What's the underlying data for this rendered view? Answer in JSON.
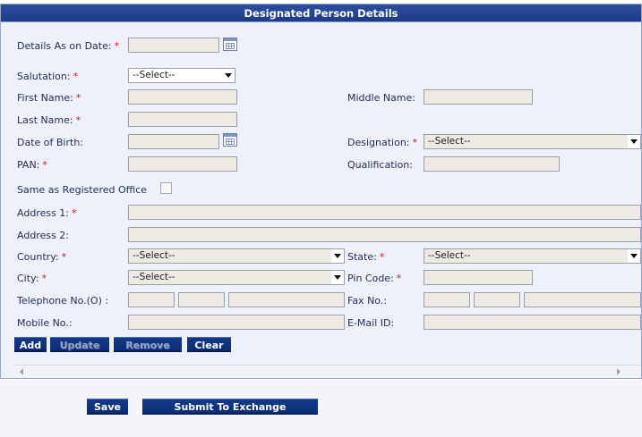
{
  "panel": {
    "title": "Designated Person Details"
  },
  "form": {
    "details_as_on_date": {
      "label": "Details As on Date:",
      "value": ""
    },
    "salutation": {
      "label": "Salutation:",
      "value": "--Select--"
    },
    "first_name": {
      "label": "First Name:",
      "value": ""
    },
    "middle_name": {
      "label": "Middle Name:",
      "value": ""
    },
    "last_name": {
      "label": "Last Name:",
      "value": ""
    },
    "date_of_birth": {
      "label": "Date of Birth:",
      "value": ""
    },
    "designation": {
      "label": "Designation:",
      "value": "--Select--"
    },
    "pan": {
      "label": "PAN:",
      "value": ""
    },
    "qualification": {
      "label": "Qualification:",
      "value": ""
    },
    "same_as_registered_office": {
      "label": "Same as Registered Office",
      "checked": false
    },
    "address1": {
      "label": "Address 1:",
      "value": ""
    },
    "address2": {
      "label": "Address 2:",
      "value": ""
    },
    "country": {
      "label": "Country:",
      "value": "--Select--"
    },
    "state": {
      "label": "State:",
      "value": "--Select--"
    },
    "city": {
      "label": "City:",
      "value": "--Select--"
    },
    "pin_code": {
      "label": "Pin Code:",
      "value": ""
    },
    "telephone": {
      "label": "Telephone No.(O) :",
      "values": [
        "",
        "",
        ""
      ]
    },
    "fax": {
      "label": "Fax No.:",
      "values": [
        "",
        "",
        ""
      ]
    },
    "mobile": {
      "label": "Mobile No.:",
      "value": ""
    },
    "email": {
      "label": "E-Mail ID:",
      "value": ""
    },
    "required_marker": "*"
  },
  "actions": {
    "add": "Add",
    "update": "Update",
    "remove": "Remove",
    "clear": "Clear"
  },
  "footer": {
    "save": "Save",
    "submit": "Submit To Exchange"
  },
  "colors": {
    "header_bg": "#1d3a86",
    "panel_bg": "#eef1fa",
    "field_bg": "#eceae3",
    "required": "#d01818",
    "button_bg": "#0c2d73"
  }
}
